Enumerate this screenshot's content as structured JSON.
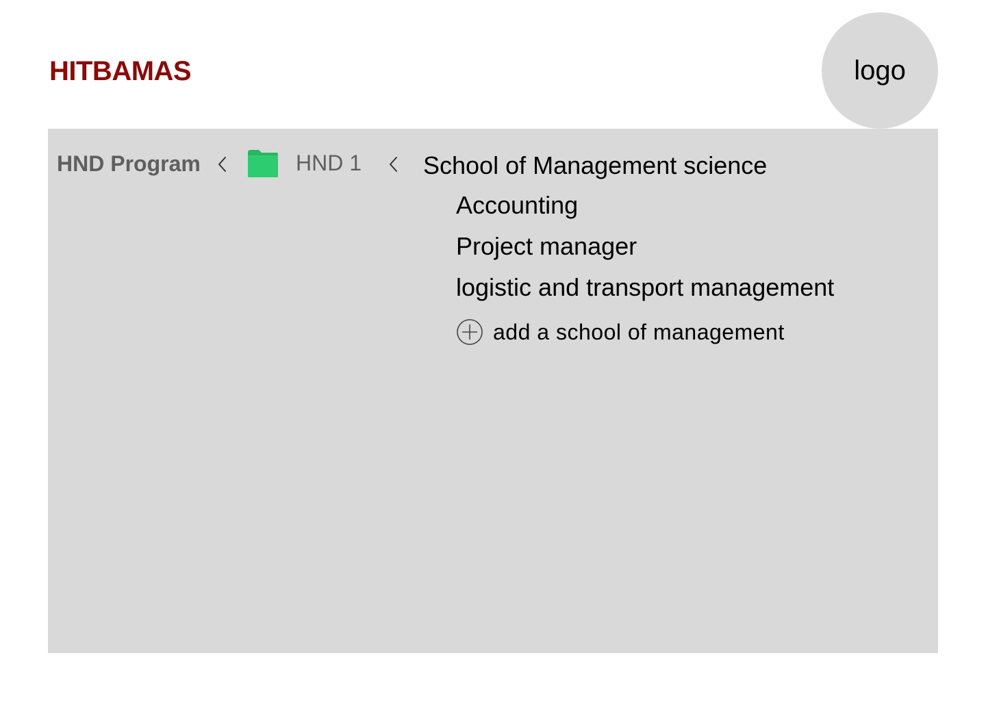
{
  "header": {
    "app_title": "HITBAMAS",
    "logo_label": "logo"
  },
  "breadcrumb": {
    "items": [
      {
        "label": "HND Program"
      },
      {
        "label": "HND 1",
        "icon": "folder-icon"
      }
    ],
    "separator_icon": "chevron-left-icon",
    "folder_color": "#2ecc71"
  },
  "school": {
    "title": "School of Management science",
    "programs": [
      {
        "label": "Accounting"
      },
      {
        "label": "Project manager"
      },
      {
        "label": "logistic and transport management"
      }
    ],
    "add_label": "add a school of management",
    "add_icon": "plus-circle-icon"
  },
  "colors": {
    "brand": "#8b0a0a",
    "panel": "#d9d9d9",
    "muted_text": "#5f5f5f"
  }
}
